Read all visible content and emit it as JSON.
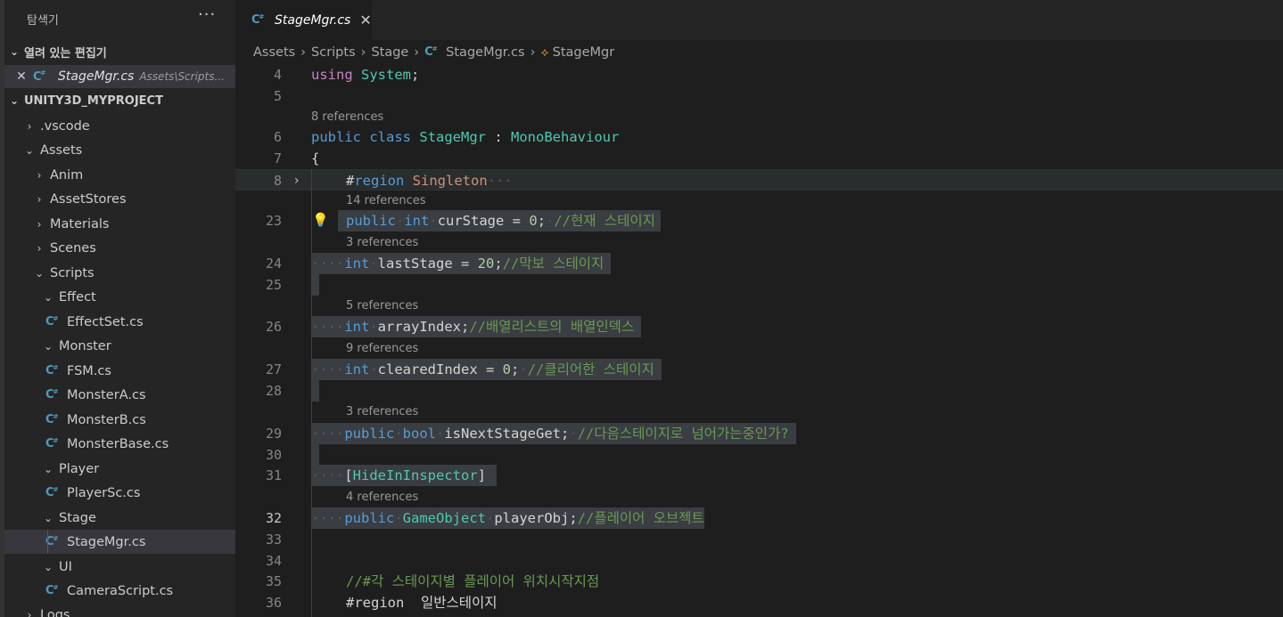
{
  "sidebar": {
    "title": "탐색기",
    "more": "···",
    "open_editors_label": "열려 있는 편집기",
    "open_editor": {
      "name": "StageMgr.cs",
      "path": "Assets\\Scripts..."
    },
    "project_label": "UNITY3D_MYPROJECT",
    "tree": [
      {
        "label": ".vscode",
        "type": "folder",
        "expanded": false
      },
      {
        "label": "Assets",
        "type": "folder",
        "expanded": true
      },
      {
        "label": "Anim",
        "type": "folder",
        "expanded": false
      },
      {
        "label": "AssetStores",
        "type": "folder",
        "expanded": false
      },
      {
        "label": "Materials",
        "type": "folder",
        "expanded": false
      },
      {
        "label": "Scenes",
        "type": "folder",
        "expanded": false
      },
      {
        "label": "Scripts",
        "type": "folder",
        "expanded": true
      },
      {
        "label": "Effect",
        "type": "folder",
        "expanded": true
      },
      {
        "label": "EffectSet.cs",
        "type": "file"
      },
      {
        "label": "Monster",
        "type": "folder",
        "expanded": true
      },
      {
        "label": "FSM.cs",
        "type": "file"
      },
      {
        "label": "MonsterA.cs",
        "type": "file"
      },
      {
        "label": "MonsterB.cs",
        "type": "file"
      },
      {
        "label": "MonsterBase.cs",
        "type": "file"
      },
      {
        "label": "Player",
        "type": "folder",
        "expanded": true
      },
      {
        "label": "PlayerSc.cs",
        "type": "file"
      },
      {
        "label": "Stage",
        "type": "folder",
        "expanded": true
      },
      {
        "label": "StageMgr.cs",
        "type": "file",
        "selected": true
      },
      {
        "label": "UI",
        "type": "folder",
        "expanded": true
      },
      {
        "label": "CameraScript.cs",
        "type": "file"
      },
      {
        "label": "Logs",
        "type": "folder",
        "expanded": false
      }
    ]
  },
  "tab": {
    "name": "StageMgr.cs",
    "close": "✕"
  },
  "breadcrumbs": [
    "Assets",
    "Scripts",
    "Stage",
    "StageMgr.cs",
    "StageMgr"
  ],
  "editor": {
    "lines": {
      "n4": "4",
      "n5": "5",
      "n6": "6",
      "n7": "7",
      "n8": "8",
      "n23": "23",
      "n24": "24",
      "n25": "25",
      "n26": "26",
      "n27": "27",
      "n28": "28",
      "n29": "29",
      "n30": "30",
      "n31": "31",
      "n32": "32",
      "n33": "33",
      "n34": "34",
      "n35": "35",
      "n36": "36"
    },
    "lenses": {
      "class_refs": "8 references",
      "curstage_refs": "14 references",
      "laststage_refs": "3 references",
      "arrayindex_refs": "5 references",
      "clearedindex_refs": "9 references",
      "isnext_refs": "3 references",
      "playerobj_refs": "4 references"
    },
    "code": {
      "using_kw": "using",
      "using_ns": "System",
      "semi": ";",
      "public": "public",
      "class": "class",
      "classname": "StageMgr",
      "colon": " : ",
      "base": "MonoBehaviour",
      "open_brace": "{",
      "region_hash": "#",
      "region_kw": "region",
      "region_name": " Singleton",
      "region_ellipsis": "···",
      "int": "int",
      "bool": "bool",
      "curstage": "curStage",
      "eq": " = ",
      "zero": "0",
      "twenty": "20",
      "curstage_cm": "//현재 스테이지",
      "laststage": "lastStage",
      "laststage_cm": "//막보 스테이지",
      "arrayindex": "arrayIndex",
      "arrayindex_cm": "//배열리스트의 배열인덱스",
      "clearedindex": "clearedIndex",
      "clearedindex_cm": "//클리어한 스테이지",
      "isnext": "isNextStageGet",
      "isnext_cm": "//다음스테이지로 넘어가는중인가?",
      "attr_open": "[",
      "attr": "HideInInspector",
      "attr_close": "]",
      "gameobject": "GameObject",
      "playerobj": "playerObj",
      "playerobj_cm": "//플레이어 오브젝트",
      "line35_cm": "//#각 스테이지별 플레이어 위치시작지점",
      "line36_region": "#region",
      "line36_name": "  일반스테이지"
    }
  },
  "colors": {
    "keyword": "#569cd6",
    "type": "#4ec9b0",
    "comment": "#6a9955",
    "number": "#b5cea8",
    "csharp_icon": "#519aba"
  }
}
